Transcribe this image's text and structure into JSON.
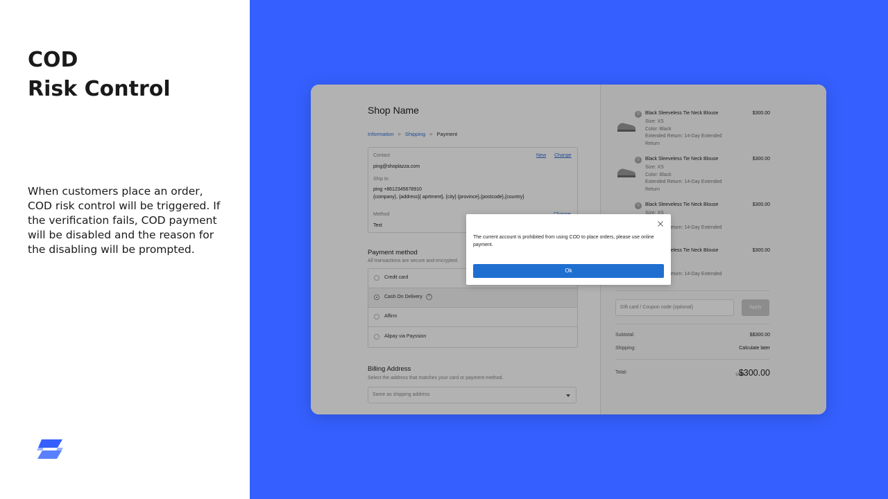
{
  "slide": {
    "title_line1": "COD",
    "title_line2": "Risk Control",
    "description": "When customers place an order, COD risk control will be triggered. If the verification fails, COD payment will be disabled and the reason for the disabling will be prompted.",
    "accent_color": "#3560ff",
    "logo_icon": "shoplazza-logo-icon"
  },
  "checkout": {
    "shop_name": "Shop Name",
    "breadcrumb": {
      "step1": "Information",
      "step2": "Shipping",
      "step3": "Payment",
      "separator": ">"
    },
    "info": {
      "contact_label": "Contact",
      "contact_value": "ping@shoplazza.com",
      "new_link": "New",
      "change_link": "Change",
      "shipto_label": "Ship to",
      "shipto_line1": "ping +8612345678910",
      "shipto_line2": "{company}, {address}{ aprtment}, {city} {province},{postcode},{country}",
      "method_label": "Method",
      "method_value": "Text",
      "method_change": "Change"
    },
    "payment": {
      "title": "Payment method",
      "subtitle": "All transactions are secure and encrypted.",
      "options": [
        {
          "label": "Credit card",
          "selected": false
        },
        {
          "label": "Cash On Delivery",
          "selected": true
        },
        {
          "label": "Affirm",
          "selected": false
        },
        {
          "label": "Alipay via Payssion",
          "selected": false
        }
      ]
    },
    "billing": {
      "title": "Billing Address",
      "subtitle": "Select the address that matches your card or payment method.",
      "select_value": "Same as shipping address"
    }
  },
  "summary": {
    "items": [
      {
        "qty": "0",
        "name": "Black Sleeveless Tie Neck Blouse",
        "price": "$300.00",
        "size": "Size: XS",
        "color": "Color: Black",
        "extra": "Extended Return: 14-Day Extended Return"
      },
      {
        "qty": "0",
        "name": "Black Sleeveless Tie Neck Blouse",
        "price": "$300.00",
        "size": "Size: XS",
        "color": "Color: Black",
        "extra": "Extended Return: 14-Day Extended Return"
      },
      {
        "qty": "0",
        "name": "Black Sleeveless Tie Neck Blouse",
        "price": "$300.00",
        "size": "Size: XS",
        "color": "",
        "extra": "Extended Return: 14-Day Extended"
      },
      {
        "qty": "",
        "name": "Black Sleeveless Tie Neck Blouse",
        "price": "$300.00",
        "size": "",
        "color": "",
        "extra": "Extended Return: 14-Day Extended"
      }
    ],
    "coupon_placeholder": "Gift card / Coupon code (optional)",
    "apply_label": "Apply",
    "subtotal_label": "Subtotal:",
    "subtotal_value": "$$300.00",
    "shipping_label": "Shipping:",
    "shipping_value": "Calculate later",
    "total_label": "Total:",
    "total_currency": "USD",
    "total_value": "$300.00"
  },
  "modal": {
    "message": "The current account is prohibited from using COD to place orders, please use online payment.",
    "ok_label": "Ok",
    "button_color": "#1f6fd1"
  }
}
